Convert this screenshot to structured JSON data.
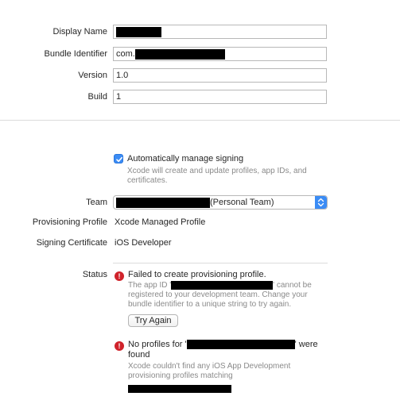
{
  "identity": {
    "display_name_label": "Display Name",
    "bundle_identifier_label": "Bundle Identifier",
    "bundle_identifier_prefix": "com.",
    "version_label": "Version",
    "version_value": "1.0",
    "build_label": "Build",
    "build_value": "1"
  },
  "signing": {
    "auto_manage_label": "Automatically manage signing",
    "auto_manage_checked": true,
    "auto_manage_desc_line1": "Xcode will create and update profiles, app IDs, and",
    "auto_manage_desc_line2": "certificates.",
    "team_label": "Team",
    "team_suffix": "(Personal Team)",
    "provisioning_profile_label": "Provisioning Profile",
    "provisioning_profile_value": "Xcode Managed Profile",
    "signing_certificate_label": "Signing Certificate",
    "signing_certificate_value": "iOS Developer"
  },
  "status": {
    "label": "Status",
    "error1": {
      "title": "Failed to create provisioning profile.",
      "line1_prefix": "The app ID '",
      "line1_suffix": "' cannot be",
      "line2": "registered to your development team. Change your",
      "line3": "bundle identifier to a unique string to try again.",
      "button_label": "Try Again"
    },
    "error2": {
      "title_prefix": "No profiles for '",
      "title_suffix": "' were",
      "title_line2": "found",
      "line1": "Xcode couldn't find any iOS App Development",
      "line2": "provisioning profiles matching"
    }
  },
  "icons": {
    "error": "error-icon",
    "check": "checkmark-icon",
    "popup_arrows": "popup-arrows-icon"
  },
  "colors": {
    "accent": "#3b8cf5",
    "error": "#d0232b",
    "secondary_text": "#8a8a8a",
    "redaction": "#000000"
  }
}
